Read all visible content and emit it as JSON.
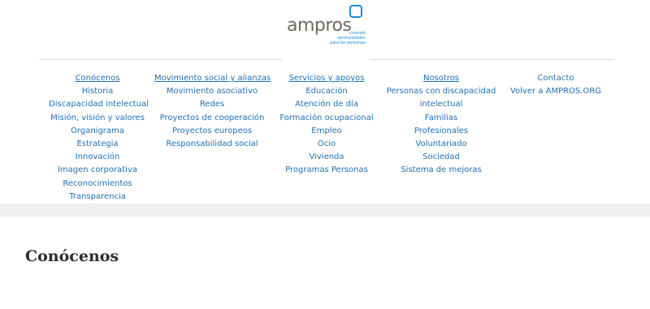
{
  "brand": {
    "name": "ampros",
    "tagline": [
      "creando",
      "oportunidades",
      "para las personas"
    ],
    "accent_color": "#1c8fd3",
    "text_color": "#6f6a63"
  },
  "menu": {
    "link_color": "#1f6fb5",
    "columns": [
      {
        "heading": "Conócenos",
        "items": [
          "Historia",
          "Discapacidad intelectual",
          "Misión, visión y valores",
          "Organigrama",
          "Estrategia",
          "Innovación",
          "Imagen corporativa",
          "Reconocimientos",
          "Transparencia"
        ]
      },
      {
        "heading": "Movimiento social y alianzas",
        "items": [
          "Movimiento asociativo",
          "Redes",
          "Proyectos de cooperación",
          "Proyectos europeos",
          "Responsabilidad social"
        ]
      },
      {
        "heading": "Servicios y apoyos",
        "items": [
          "Educación",
          "Atención de día",
          "Formación ocupacional",
          "Empleo",
          "Ocio",
          "Vivienda",
          "Programas Personas"
        ]
      },
      {
        "heading": "Nosotros",
        "items": [
          "Personas con discapacidad",
          "intelectual",
          "Familias",
          "Profesionales",
          "Voluntariado",
          "Sociedad",
          "Sistema de mejoras"
        ]
      },
      {
        "heading": "",
        "items": [
          "Contacto",
          "Volver a AMPROS.ORG"
        ]
      }
    ]
  },
  "content": {
    "section_title": "Conócenos"
  }
}
